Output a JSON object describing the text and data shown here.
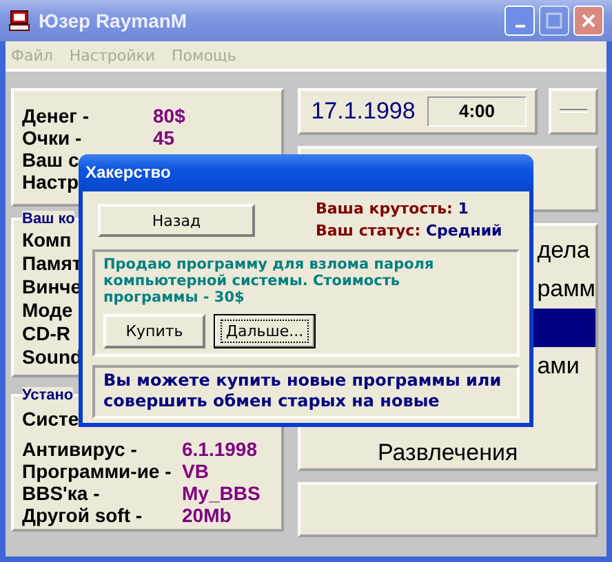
{
  "window": {
    "title": "Юзер RaymanM"
  },
  "menu": [
    {
      "label": "Файл",
      "disabled": true
    },
    {
      "label": "Настройки",
      "disabled": true
    },
    {
      "label": "Помощь",
      "disabled": true
    }
  ],
  "stats": [
    {
      "label": "Денег -",
      "value": "80$"
    },
    {
      "label": "Очки -",
      "value": "45"
    },
    {
      "label": "Ваш с"
    },
    {
      "label": "Настр"
    }
  ],
  "computer": {
    "title": "Ваш ко",
    "items": [
      "Комп",
      "Памят",
      "Винче",
      "Моде",
      "CD-R",
      "Sound"
    ]
  },
  "installed": {
    "title": "Устано",
    "items": [
      {
        "label": "Систе"
      },
      {
        "label": "Антивирус -",
        "value": "6.1.1998"
      },
      {
        "label": "Программи-ие -",
        "value": "VB"
      },
      {
        "label": "BBS'ка -",
        "value": "My_BBS"
      },
      {
        "label": "Другой soft -",
        "value": "20Mb"
      }
    ]
  },
  "date": "17.1.1998",
  "time": "4:00",
  "sections": [
    {
      "label": "дела",
      "kind": "clipped",
      "selected": false
    },
    {
      "label": "рамм",
      "kind": "clipped",
      "selected": false
    },
    {
      "kind": "clipped",
      "selected": true
    },
    {
      "label": "ами",
      "kind": "clipped",
      "selected": false
    },
    {
      "kind": "clipped",
      "selected": false
    },
    {
      "label": "Развлечения",
      "kind": "full",
      "selected": false
    }
  ],
  "dialog": {
    "title": "Хакерство",
    "back_button": "Назад",
    "coolness_label": "Ваша крутость:",
    "coolness": "1",
    "status_label": "Ваш статус:",
    "status": "Средний",
    "offer": "Продаю программу для взлома пароля компьютерной системы. Стоимость программы - 30$",
    "buttons": [
      {
        "label": "Купить",
        "focused": false
      },
      {
        "label": "Дальше...",
        "focused": true
      }
    ],
    "hint": "Вы можете купить новые программы или совершить обмен старых на новые"
  }
}
